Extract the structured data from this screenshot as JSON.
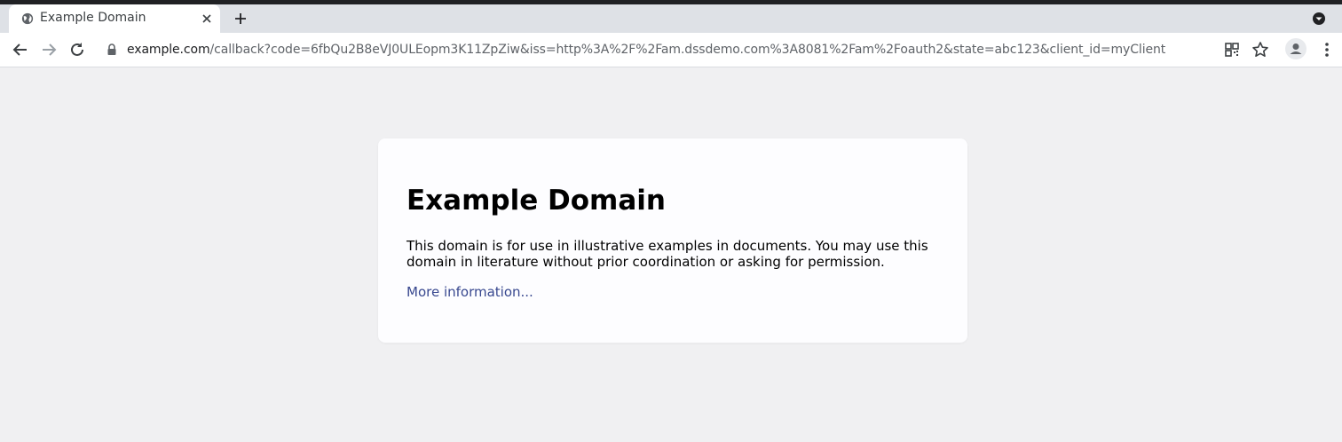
{
  "browser": {
    "tab": {
      "title": "Example Domain"
    },
    "url": {
      "host": "example.com",
      "path": "/callback?code=6fbQu2B8eVJ0ULEopm3K11ZpZiw&iss=http%3A%2F%2Fam.dssdemo.com%3A8081%2Fam%2Foauth2&state=abc123&client_id=myClient"
    },
    "icons": {
      "tab_favicon": "globe-icon",
      "tab_close": "close-icon",
      "new_tab": "plus-icon",
      "tab_search": "chevron-down-circle-icon",
      "back": "arrow-left-icon",
      "forward": "arrow-right-icon",
      "reload": "reload-icon",
      "lock": "lock-icon",
      "qr": "qr-code-icon",
      "bookmark": "star-icon",
      "profile": "person-icon",
      "menu": "more-vertical-icon"
    }
  },
  "page": {
    "heading": "Example Domain",
    "description": "This domain is for use in illustrative examples in documents. You may use this domain in literature without prior coordination or asking for permission.",
    "link_text": "More information..."
  },
  "colors": {
    "page_background": "#f0f0f2",
    "card_background": "#fdfdff",
    "link": "#38488f"
  }
}
